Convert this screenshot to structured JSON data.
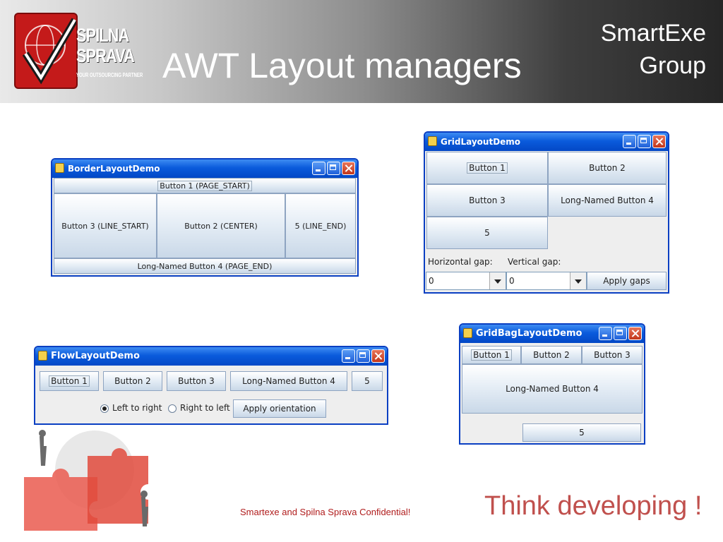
{
  "slide": {
    "title": "AWT Layout managers",
    "brand_line1": "SmartExe",
    "brand_line2": "Group",
    "logo_line1": "SPILNA",
    "logo_line2": "SPRAVA",
    "logo_tagline": "YOUR OUTSOURCING PARTNER",
    "footer": "Smartexe and Spilna Sprava Confidential!",
    "tagline": "Think developing !"
  },
  "border_demo": {
    "title": "BorderLayoutDemo",
    "page_start": "Button 1 (PAGE_START)",
    "line_start": "Button 3 (LINE_START)",
    "center": "Button 2 (CENTER)",
    "line_end": "5 (LINE_END)",
    "page_end": "Long-Named Button 4 (PAGE_END)"
  },
  "grid_demo": {
    "title": "GridLayoutDemo",
    "buttons": [
      "Button 1",
      "Button 2",
      "Button 3",
      "Long-Named Button 4",
      "5"
    ],
    "hgap_label": "Horizontal gap:",
    "vgap_label": "Vertical gap:",
    "hgap_value": "0",
    "vgap_value": "0",
    "apply": "Apply gaps"
  },
  "flow_demo": {
    "title": "FlowLayoutDemo",
    "buttons": [
      "Button 1",
      "Button 2",
      "Button 3",
      "Long-Named Button 4",
      "5"
    ],
    "ltr": "Left to right",
    "rtl": "Right to left",
    "apply": "Apply orientation",
    "selected": "Left to right"
  },
  "gridbag_demo": {
    "title": "GridBagLayoutDemo",
    "buttons": [
      "Button 1",
      "Button 2",
      "Button 3",
      "Long-Named Button 4",
      "5"
    ]
  },
  "colors": {
    "title_bar": "#0a5bdc",
    "footer_text": "#b01c1c",
    "tagline_text": "#c0504d"
  }
}
